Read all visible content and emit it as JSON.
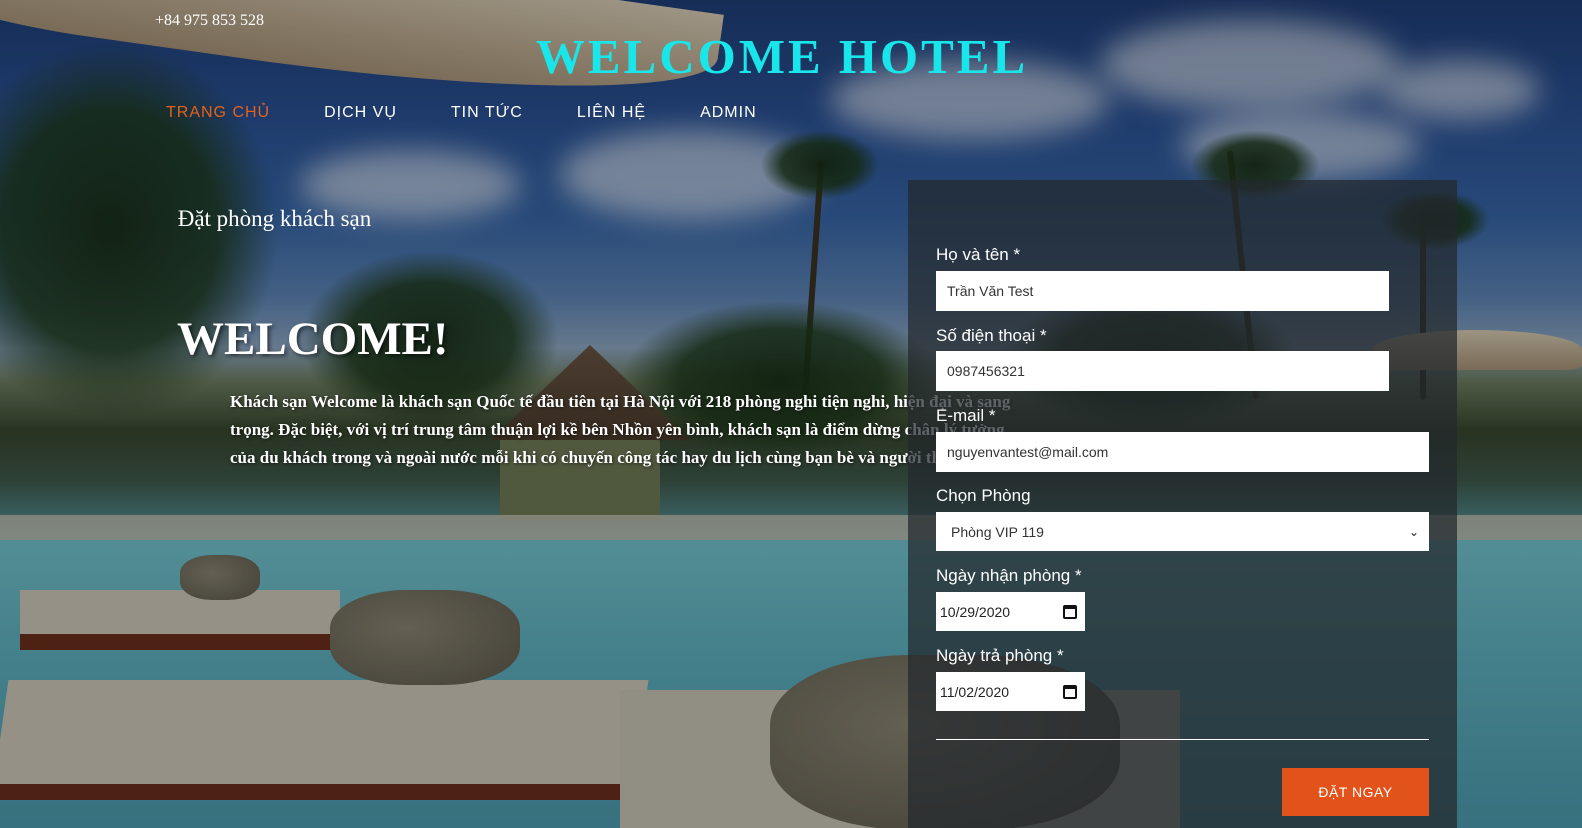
{
  "header": {
    "phone": "+84 975 853 528",
    "brand": "WELCOME HOTEL"
  },
  "nav": {
    "items": [
      {
        "label": "TRANG CHỦ",
        "active": true
      },
      {
        "label": "DỊCH VỤ",
        "active": false
      },
      {
        "label": "TIN TỨC",
        "active": false
      },
      {
        "label": "LIÊN HỆ",
        "active": false
      },
      {
        "label": "ADMIN",
        "active": false
      }
    ]
  },
  "hero": {
    "title": "WELCOME!",
    "text": "Khách sạn Welcome là khách sạn Quốc tế đầu tiên tại Hà Nội với 218 phòng nghi tiện nghi, hiện đại và sang trọng. Đặc biệt, với vị trí trung tâm thuận lợi kề bên Nhồn yên bình, khách sạn là điểm dừng chân lý tưởng của du khách trong và ngoài nước mỗi khi có chuyến công tác hay du lịch cùng bạn bè và người thân."
  },
  "booking": {
    "title": "Đặt phòng khách sạn",
    "name_label": "Họ và tên *",
    "name_value": "Trần Văn Test",
    "phone_label": "Số điện thoại *",
    "phone_value": "0987456321",
    "email_label": "E-mail *",
    "email_value": "nguyenvantest@mail.com",
    "room_label": "Chọn Phòng",
    "room_selected": "Phòng VIP 119",
    "checkin_label": "Ngày nhận phòng *",
    "checkin_value": "10/29/2020",
    "checkout_label": "Ngày trả phòng *",
    "checkout_value": "11/02/2020",
    "submit_label": "ĐẶT NGAY"
  },
  "colors": {
    "brand": "#19e6ea",
    "nav_active": "#e6611b",
    "submit": "#e2531b"
  }
}
